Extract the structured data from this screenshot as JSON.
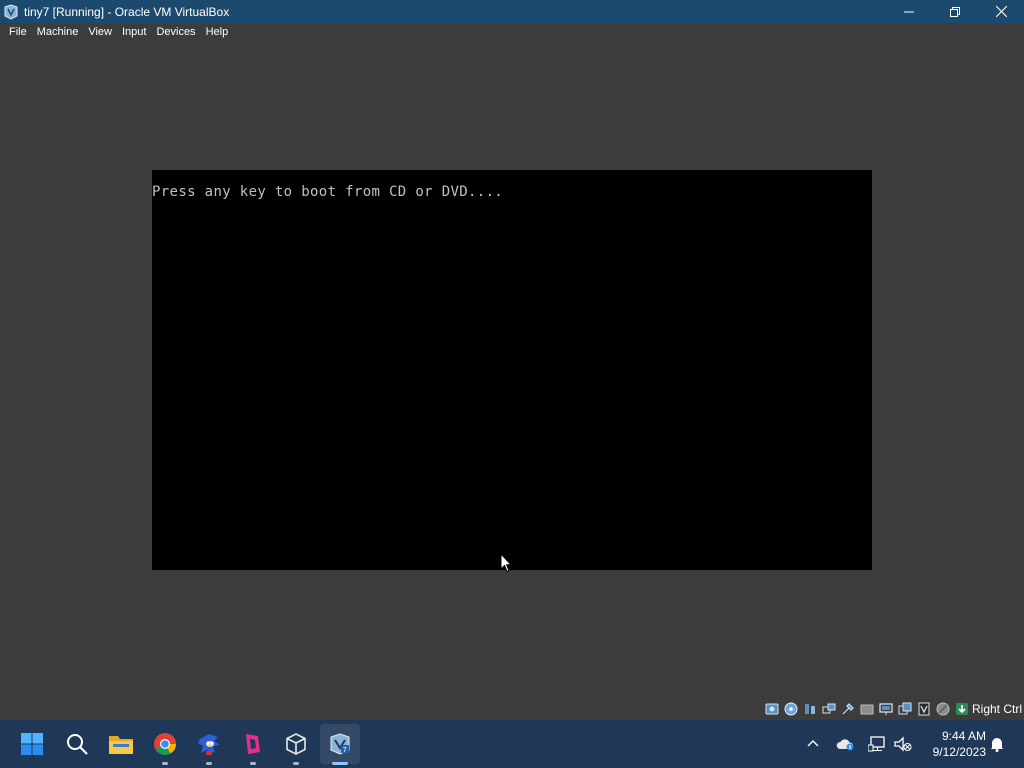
{
  "window": {
    "title": "tiny7 [Running] - Oracle VM VirtualBox",
    "minimize_icon": "minimize-icon",
    "maximize_icon": "restore-icon",
    "close_icon": "close-icon"
  },
  "menu": {
    "items": [
      {
        "label": "File"
      },
      {
        "label": "Machine"
      },
      {
        "label": "View"
      },
      {
        "label": "Input"
      },
      {
        "label": "Devices"
      },
      {
        "label": "Help"
      }
    ]
  },
  "vm": {
    "console_text": "Press any key to boot from CD or DVD....",
    "screen_color": "#000000",
    "text_color": "#c0c0c0"
  },
  "statusbar": {
    "icons": [
      "hard-disk-icon",
      "optical-drive-icon",
      "audio-icon",
      "network-icon",
      "usb-icon",
      "shared-folders-icon",
      "display-icon",
      "recording-icon",
      "cpu-icon",
      "mouse-integration-icon",
      "host-key-arrow-icon"
    ],
    "host_key": "Right Ctrl"
  },
  "taskbar": {
    "apps": [
      "start-icon",
      "search-icon",
      "file-explorer-icon",
      "chrome-icon",
      "sonic-app-icon",
      "pink-app-icon",
      "virtualbox-icon",
      "vm-window-icon"
    ],
    "tray": [
      "chevron-up-icon",
      "onedrive-icon",
      "network-icon",
      "volume-muted-icon"
    ],
    "time": "9:44 AM",
    "date": "9/12/2023",
    "notification_icon": "bell-icon"
  },
  "colors": {
    "titlebar": "#1c4a6e",
    "background": "#3c3c3c",
    "taskbar": "#1f3857",
    "accent": "#8fc4ff"
  }
}
